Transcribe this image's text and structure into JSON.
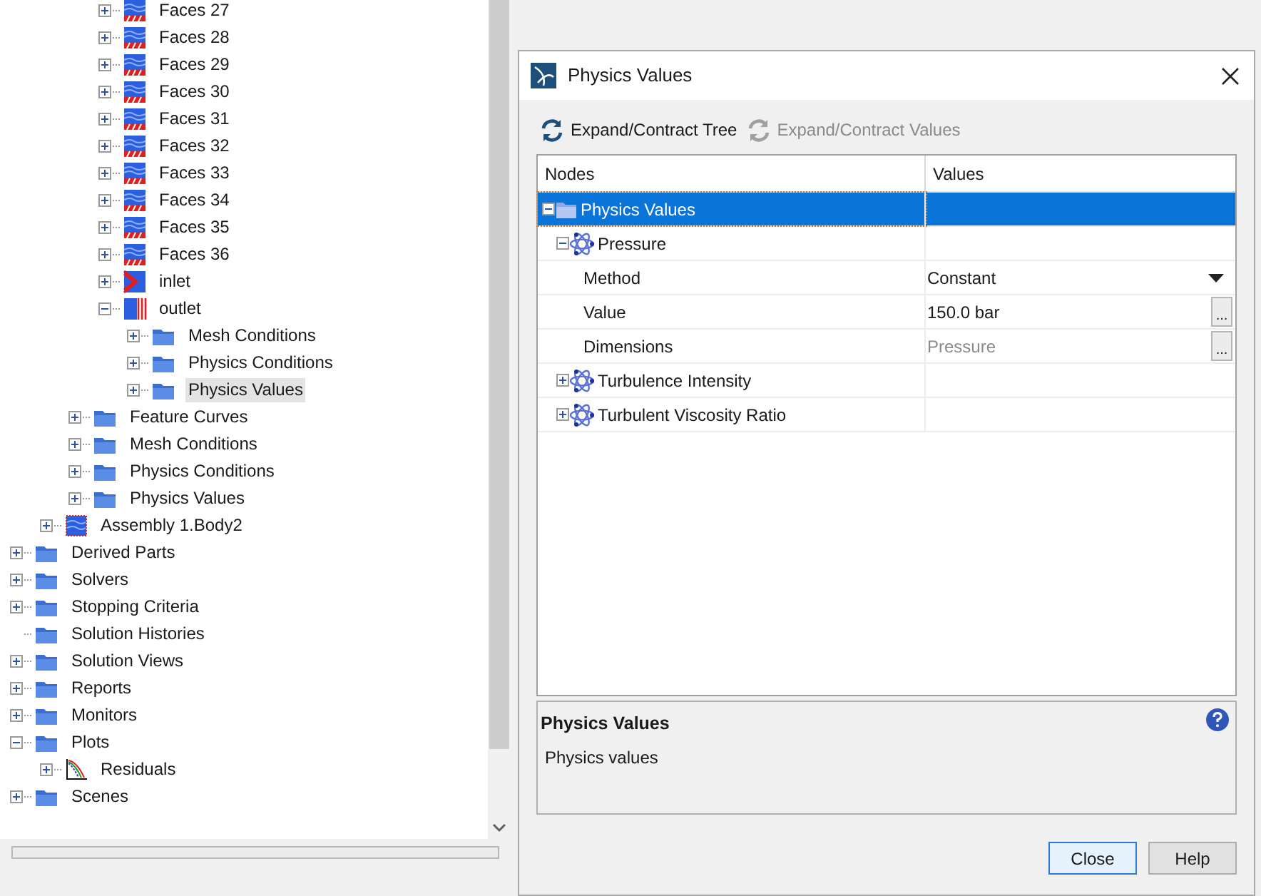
{
  "tree": {
    "items": [
      {
        "children": [
          {
            "children": [
              {
                "children": [
                  {
                    "label": "Faces 27",
                    "kind": "faces",
                    "expanded": false,
                    "selected": false
                  },
                  {
                    "label": "Faces 28",
                    "kind": "faces",
                    "expanded": false,
                    "selected": false
                  },
                  {
                    "label": "Faces 29",
                    "kind": "faces",
                    "expanded": false,
                    "selected": false
                  },
                  {
                    "label": "Faces 30",
                    "kind": "faces",
                    "expanded": false,
                    "selected": false
                  },
                  {
                    "label": "Faces 31",
                    "kind": "faces",
                    "expanded": false,
                    "selected": false
                  },
                  {
                    "label": "Faces 32",
                    "kind": "faces",
                    "expanded": false,
                    "selected": false
                  },
                  {
                    "label": "Faces 33",
                    "kind": "faces",
                    "expanded": false,
                    "selected": false
                  },
                  {
                    "label": "Faces 34",
                    "kind": "faces",
                    "expanded": false,
                    "selected": false
                  },
                  {
                    "label": "Faces 35",
                    "kind": "faces",
                    "expanded": false,
                    "selected": false
                  },
                  {
                    "label": "Faces 36",
                    "kind": "faces",
                    "expanded": false,
                    "selected": false
                  },
                  {
                    "label": "inlet",
                    "kind": "inlet",
                    "expanded": false,
                    "selected": false
                  },
                  {
                    "label": "outlet",
                    "kind": "outlet",
                    "expanded": true,
                    "selected": false,
                    "children": [
                      {
                        "label": "Mesh Conditions",
                        "kind": "folder",
                        "expanded": false,
                        "selected": false
                      },
                      {
                        "label": "Physics Conditions",
                        "kind": "folder",
                        "expanded": false,
                        "selected": false
                      },
                      {
                        "label": "Physics Values",
                        "kind": "folder",
                        "expanded": false,
                        "selected": true
                      }
                    ]
                  }
                ]
              },
              {
                "label": "Feature Curves",
                "kind": "folder",
                "expanded": false,
                "selected": false
              },
              {
                "label": "Mesh Conditions",
                "kind": "folder",
                "expanded": false,
                "selected": false
              },
              {
                "label": "Physics Conditions",
                "kind": "folder",
                "expanded": false,
                "selected": false
              },
              {
                "label": "Physics Values",
                "kind": "folder",
                "expanded": false,
                "selected": false
              }
            ]
          },
          {
            "label": "Assembly 1.Body2",
            "kind": "body",
            "expanded": false,
            "selected": false
          }
        ]
      },
      {
        "label": "Derived Parts",
        "kind": "folder",
        "expanded": false,
        "selected": false
      },
      {
        "label": "Solvers",
        "kind": "folder",
        "expanded": false,
        "selected": false
      },
      {
        "label": "Stopping Criteria",
        "kind": "folder",
        "expanded": false,
        "selected": false
      },
      {
        "label": "Solution Histories",
        "kind": "folder",
        "selected": false
      },
      {
        "label": "Solution Views",
        "kind": "folder",
        "expanded": false,
        "selected": false
      },
      {
        "label": "Reports",
        "kind": "folder",
        "expanded": false,
        "selected": false
      },
      {
        "label": "Monitors",
        "kind": "folder",
        "expanded": false,
        "selected": false
      },
      {
        "label": "Plots",
        "kind": "folder",
        "expanded": true,
        "selected": false,
        "children": [
          {
            "label": "Residuals",
            "kind": "plot",
            "expanded": false,
            "selected": false
          }
        ]
      },
      {
        "label": "Scenes",
        "kind": "folder",
        "expanded": false,
        "selected": false
      }
    ]
  },
  "dialog": {
    "title": "Physics Values",
    "toolbar": [
      {
        "label": "Expand/Contract Tree",
        "disabled": false
      },
      {
        "label": "Expand/Contract Values",
        "disabled": true
      }
    ],
    "table": {
      "columns": [
        "Nodes",
        "Values"
      ],
      "rows": [
        {
          "label": "Physics Values",
          "kind": "folder",
          "expanded": true,
          "selected": true,
          "children": [
            {
              "label": "Pressure",
              "kind": "node",
              "expanded": true,
              "selected": false,
              "children": [
                {
                  "label": "Method",
                  "kind": "dropdown",
                  "value": "Constant",
                  "disabled": false,
                  "selected": false
                },
                {
                  "label": "Value",
                  "kind": "ellipsis",
                  "value": "150.0 bar",
                  "button": "...",
                  "disabled": false,
                  "selected": false
                },
                {
                  "label": "Dimensions",
                  "kind": "ellipsis",
                  "value": "Pressure",
                  "button": "...",
                  "disabled": true,
                  "selected": false
                }
              ]
            },
            {
              "label": "Turbulence Intensity",
              "kind": "node",
              "expanded": false,
              "selected": false
            },
            {
              "label": "Turbulent Viscosity Ratio",
              "kind": "node",
              "expanded": false,
              "selected": false
            }
          ]
        }
      ]
    },
    "description": {
      "title": "Physics Values",
      "text": "Physics values"
    },
    "buttons": [
      {
        "label": "Close",
        "default": true
      },
      {
        "label": "Help",
        "default": false
      }
    ]
  }
}
